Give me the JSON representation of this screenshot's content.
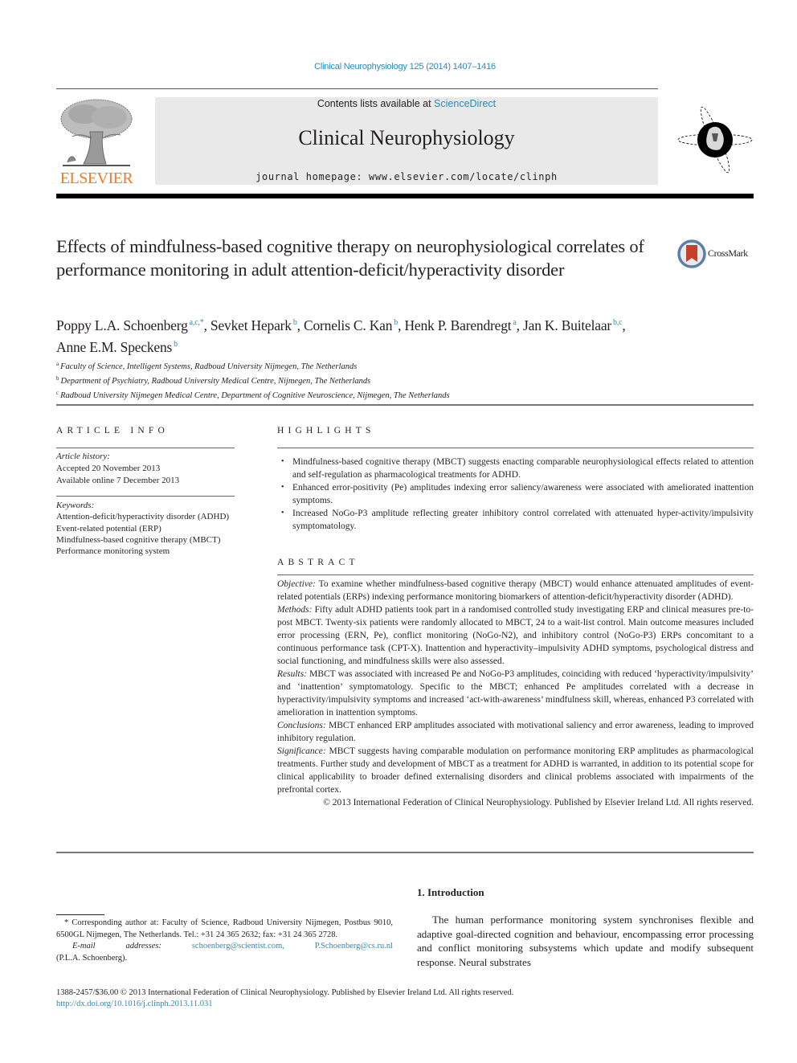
{
  "header": {
    "journal_ref": "Clinical Neurophysiology 125 (2014) 1407–1416",
    "contents_prefix": "Contents lists available at ",
    "contents_link": "ScienceDirect",
    "journal_title": "Clinical Neurophysiology",
    "homepage_prefix": "journal homepage: ",
    "homepage_url": "www.elsevier.com/locate/clinph",
    "publisher_logo_text": "ELSEVIER",
    "publisher_color": "#f47a20",
    "link_color": "#2a8ab8"
  },
  "article": {
    "title": "Effects of mindfulness-based cognitive therapy on neurophysiological correlates of performance monitoring in adult attention-deficit/hyperactivity disorder",
    "crossmark_label": "CrossMark",
    "authors": [
      {
        "name": "Poppy L.A. Schoenberg",
        "sup": "a,c,*",
        "sep": ", "
      },
      {
        "name": "Sevket Hepark",
        "sup": "b",
        "sep": ", "
      },
      {
        "name": "Cornelis C. Kan",
        "sup": "b",
        "sep": ", "
      },
      {
        "name": "Henk P. Barendregt",
        "sup": "a",
        "sep": ", "
      },
      {
        "name": "Jan K. Buitelaar",
        "sup": "b,c",
        "sep": ","
      },
      {
        "name": "Anne E.M. Speckens",
        "sup": "b",
        "sep": ""
      }
    ],
    "affiliations": [
      {
        "key": "a",
        "text": "Faculty of Science, Intelligent Systems, Radboud University Nijmegen, The Netherlands"
      },
      {
        "key": "b",
        "text": "Department of Psychiatry, Radboud University Medical Centre, Nijmegen, The Netherlands"
      },
      {
        "key": "c",
        "text": "Radboud University Nijmegen Medical Centre, Department of Cognitive Neuroscience, Nijmegen, The Netherlands"
      }
    ]
  },
  "article_info": {
    "heading": "ARTICLE INFO",
    "history_label": "Article history:",
    "history": [
      "Accepted 20 November 2013",
      "Available online 7 December 2013"
    ],
    "keywords_label": "Keywords:",
    "keywords": [
      "Attention-deficit/hyperactivity disorder (ADHD)",
      "Event-related potential (ERP)",
      "Mindfulness-based cognitive therapy (MBCT)",
      "Performance monitoring system"
    ]
  },
  "highlights": {
    "heading": "HIGHLIGHTS",
    "items": [
      "Mindfulness-based cognitive therapy (MBCT) suggests enacting comparable neurophysiological effects related to attention and self-regulation as pharmacological treatments for ADHD.",
      "Enhanced error-positivity (Pe) amplitudes indexing error saliency/awareness were associated with ameliorated inattention symptoms.",
      "Increased NoGo-P3 amplitude reflecting greater inhibitory control correlated with attenuated hyper-activity/impulsivity symptomatology."
    ]
  },
  "abstract": {
    "heading": "ABSTRACT",
    "sections": [
      {
        "label": "Objective:",
        "text": " To examine whether mindfulness-based cognitive therapy (MBCT) would enhance attenuated amplitudes of event-related potentials (ERPs) indexing performance monitoring biomarkers of attention-deficit/hyperactivity disorder (ADHD)."
      },
      {
        "label": "Methods:",
        "text": " Fifty adult ADHD patients took part in a randomised controlled study investigating ERP and clinical measures pre-to-post MBCT. Twenty-six patients were randomly allocated to MBCT, 24 to a wait-list control. Main outcome measures included error processing (ERN, Pe), conflict monitoring (NoGo-N2), and inhibitory control (NoGo-P3) ERPs concomitant to a continuous performance task (CPT-X). Inattention and hyperactivity–impulsivity ADHD symptoms, psychological distress and social functioning, and mindfulness skills were also assessed."
      },
      {
        "label": "Results:",
        "text": " MBCT was associated with increased Pe and NoGo-P3 amplitudes, coinciding with reduced ‘hyperactivity/impulsivity’ and ‘inattention’ symptomatology. Specific to the MBCT; enhanced Pe amplitudes correlated with a decrease in hyperactivity/impulsivity symptoms and increased ‘act-with-awareness’ mindfulness skill, whereas, enhanced P3 correlated with amelioration in inattention symptoms."
      },
      {
        "label": "Conclusions:",
        "text": "  MBCT enhanced ERP amplitudes associated with motivational saliency and error awareness, leading to improved inhibitory regulation."
      },
      {
        "label": "Significance:",
        "text": "  MBCT suggests having comparable modulation on performance monitoring ERP amplitudes as pharmacological treatments. Further study and development of MBCT as a treatment for ADHD is warranted, in addition to its potential scope for clinical applicability to broader defined externalising disorders and clinical problems associated with impairments of the prefrontal cortex."
      }
    ],
    "copyright": "© 2013 International Federation of Clinical Neurophysiology. Published by Elsevier Ireland Ltd. All rights reserved."
  },
  "footnote": {
    "corresponding": "* Corresponding author at: Faculty of Science, Radboud University Nijmegen, Postbus 9010, 6500GL Nijmegen, The Netherlands. Tel.: +31 24 365 2632; fax: +31 24 365 2728.",
    "email_label": "E-mail",
    "email_label2": "addresses:",
    "email_1": "schoenberg@scientist.com,",
    "email_2": "P.Schoenberg@cs.ru.nl",
    "email_owner": "(P.L.A. Schoenberg)."
  },
  "introduction": {
    "heading": "1. Introduction",
    "text": "The human performance monitoring system synchronises flexible and adaptive goal-directed cognition and behaviour, encompassing error processing and conflict monitoring subsystems which update and modify subsequent response. Neural substrates"
  },
  "footer": {
    "issn_line": "1388-2457/$36.00 © 2013 International Federation of Clinical Neurophysiology. Published by Elsevier Ireland Ltd. All rights reserved.",
    "doi": "http://dx.doi.org/10.1016/j.clinph.2013.11.031"
  }
}
